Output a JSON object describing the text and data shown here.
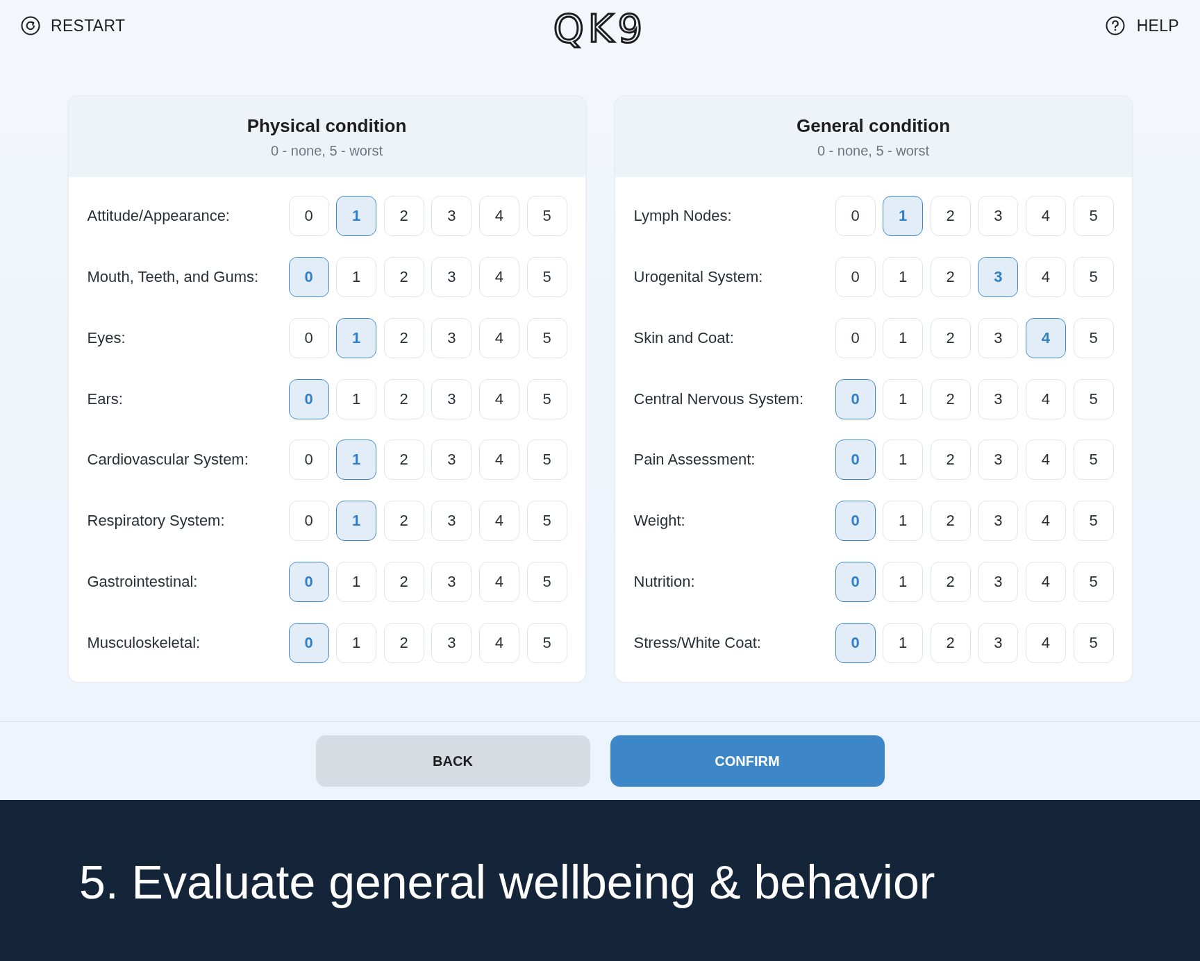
{
  "header": {
    "restart": {
      "label": "RESTART"
    },
    "logo": "QK9",
    "help": {
      "label": "HELP"
    }
  },
  "panels": [
    {
      "title": "Physical condition",
      "subtitle": "0 - none, 5 - worst",
      "rows": [
        {
          "label": "Attitude/Appearance:",
          "options": [
            {
              "label": "0",
              "selected": false
            },
            {
              "label": "1",
              "selected": true
            },
            {
              "label": "2",
              "selected": false
            },
            {
              "label": "3",
              "selected": false
            },
            {
              "label": "4",
              "selected": false
            },
            {
              "label": "5",
              "selected": false
            }
          ]
        },
        {
          "label": "Mouth, Teeth, and Gums:",
          "options": [
            {
              "label": "0",
              "selected": true
            },
            {
              "label": "1",
              "selected": false
            },
            {
              "label": "2",
              "selected": false
            },
            {
              "label": "3",
              "selected": false
            },
            {
              "label": "4",
              "selected": false
            },
            {
              "label": "5",
              "selected": false
            }
          ]
        },
        {
          "label": "Eyes:",
          "options": [
            {
              "label": "0",
              "selected": false
            },
            {
              "label": "1",
              "selected": true
            },
            {
              "label": "2",
              "selected": false
            },
            {
              "label": "3",
              "selected": false
            },
            {
              "label": "4",
              "selected": false
            },
            {
              "label": "5",
              "selected": false
            }
          ]
        },
        {
          "label": "Ears:",
          "options": [
            {
              "label": "0",
              "selected": true
            },
            {
              "label": "1",
              "selected": false
            },
            {
              "label": "2",
              "selected": false
            },
            {
              "label": "3",
              "selected": false
            },
            {
              "label": "4",
              "selected": false
            },
            {
              "label": "5",
              "selected": false
            }
          ]
        },
        {
          "label": "Cardiovascular System:",
          "options": [
            {
              "label": "0",
              "selected": false
            },
            {
              "label": "1",
              "selected": true
            },
            {
              "label": "2",
              "selected": false
            },
            {
              "label": "3",
              "selected": false
            },
            {
              "label": "4",
              "selected": false
            },
            {
              "label": "5",
              "selected": false
            }
          ]
        },
        {
          "label": "Respiratory System:",
          "options": [
            {
              "label": "0",
              "selected": false
            },
            {
              "label": "1",
              "selected": true
            },
            {
              "label": "2",
              "selected": false
            },
            {
              "label": "3",
              "selected": false
            },
            {
              "label": "4",
              "selected": false
            },
            {
              "label": "5",
              "selected": false
            }
          ]
        },
        {
          "label": "Gastrointestinal:",
          "options": [
            {
              "label": "0",
              "selected": true
            },
            {
              "label": "1",
              "selected": false
            },
            {
              "label": "2",
              "selected": false
            },
            {
              "label": "3",
              "selected": false
            },
            {
              "label": "4",
              "selected": false
            },
            {
              "label": "5",
              "selected": false
            }
          ]
        },
        {
          "label": "Musculoskeletal:",
          "options": [
            {
              "label": "0",
              "selected": true
            },
            {
              "label": "1",
              "selected": false
            },
            {
              "label": "2",
              "selected": false
            },
            {
              "label": "3",
              "selected": false
            },
            {
              "label": "4",
              "selected": false
            },
            {
              "label": "5",
              "selected": false
            }
          ]
        }
      ]
    },
    {
      "title": "General condition",
      "subtitle": "0 - none, 5 - worst",
      "rows": [
        {
          "label": "Lymph Nodes:",
          "options": [
            {
              "label": "0",
              "selected": false
            },
            {
              "label": "1",
              "selected": true
            },
            {
              "label": "2",
              "selected": false
            },
            {
              "label": "3",
              "selected": false
            },
            {
              "label": "4",
              "selected": false
            },
            {
              "label": "5",
              "selected": false
            }
          ]
        },
        {
          "label": "Urogenital System:",
          "options": [
            {
              "label": "0",
              "selected": false
            },
            {
              "label": "1",
              "selected": false
            },
            {
              "label": "2",
              "selected": false
            },
            {
              "label": "3",
              "selected": true
            },
            {
              "label": "4",
              "selected": false
            },
            {
              "label": "5",
              "selected": false
            }
          ]
        },
        {
          "label": "Skin and Coat:",
          "options": [
            {
              "label": "0",
              "selected": false
            },
            {
              "label": "1",
              "selected": false
            },
            {
              "label": "2",
              "selected": false
            },
            {
              "label": "3",
              "selected": false
            },
            {
              "label": "4",
              "selected": true
            },
            {
              "label": "5",
              "selected": false
            }
          ]
        },
        {
          "label": "Central Nervous System:",
          "options": [
            {
              "label": "0",
              "selected": true
            },
            {
              "label": "1",
              "selected": false
            },
            {
              "label": "2",
              "selected": false
            },
            {
              "label": "3",
              "selected": false
            },
            {
              "label": "4",
              "selected": false
            },
            {
              "label": "5",
              "selected": false
            }
          ]
        },
        {
          "label": "Pain Assessment:",
          "options": [
            {
              "label": "0",
              "selected": true
            },
            {
              "label": "1",
              "selected": false
            },
            {
              "label": "2",
              "selected": false
            },
            {
              "label": "3",
              "selected": false
            },
            {
              "label": "4",
              "selected": false
            },
            {
              "label": "5",
              "selected": false
            }
          ]
        },
        {
          "label": "Weight:",
          "options": [
            {
              "label": "0",
              "selected": true
            },
            {
              "label": "1",
              "selected": false
            },
            {
              "label": "2",
              "selected": false
            },
            {
              "label": "3",
              "selected": false
            },
            {
              "label": "4",
              "selected": false
            },
            {
              "label": "5",
              "selected": false
            }
          ]
        },
        {
          "label": "Nutrition:",
          "options": [
            {
              "label": "0",
              "selected": true
            },
            {
              "label": "1",
              "selected": false
            },
            {
              "label": "2",
              "selected": false
            },
            {
              "label": "3",
              "selected": false
            },
            {
              "label": "4",
              "selected": false
            },
            {
              "label": "5",
              "selected": false
            }
          ]
        },
        {
          "label": "Stress/White Coat:",
          "options": [
            {
              "label": "0",
              "selected": true
            },
            {
              "label": "1",
              "selected": false
            },
            {
              "label": "2",
              "selected": false
            },
            {
              "label": "3",
              "selected": false
            },
            {
              "label": "4",
              "selected": false
            },
            {
              "label": "5",
              "selected": false
            }
          ]
        }
      ]
    }
  ],
  "footer_buttons": [
    {
      "label": "BACK",
      "kind": "secondary"
    },
    {
      "label": "CONFIRM",
      "kind": "primary"
    }
  ],
  "caption": "5. Evaluate general wellbeing & behavior"
}
